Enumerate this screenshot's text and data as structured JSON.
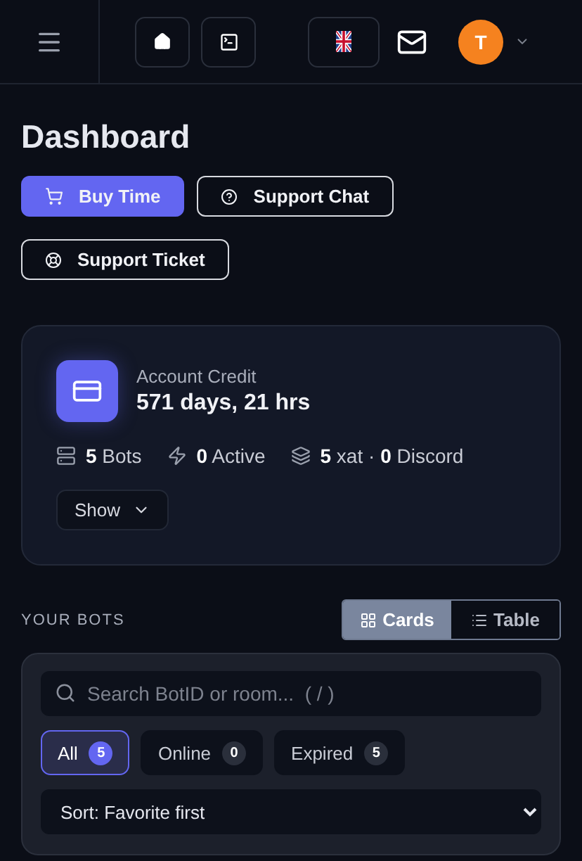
{
  "header": {
    "avatar_initial": "T"
  },
  "title": "Dashboard",
  "actions": [
    {
      "kind": "primary",
      "label": "Buy Time"
    },
    {
      "kind": "outline",
      "label": "Support Chat"
    },
    {
      "kind": "outline",
      "label": "Support Ticket"
    }
  ],
  "credit": {
    "label": "Account Credit",
    "value": "571 days, 21 hrs",
    "stats": [
      {
        "text": "**5** Bots"
      },
      {
        "text": "**0** Active"
      },
      {
        "text": "**5** xat · **0** Discord"
      }
    ],
    "show_button": "Show"
  },
  "bots": {
    "heading": "YOUR BOTS",
    "views": [
      {
        "label": "Cards",
        "selected": true
      },
      {
        "label": "Table",
        "selected": false
      }
    ],
    "search": {
      "placeholder": "Search BotID or room...  ( / )"
    },
    "filters": [
      {
        "label": "All",
        "count": "5",
        "selected": true
      },
      {
        "label": "Online",
        "count": "0",
        "selected": false
      },
      {
        "label": "Expired",
        "count": "5",
        "selected": false
      }
    ],
    "sort": "Sort: Favorite first"
  }
}
